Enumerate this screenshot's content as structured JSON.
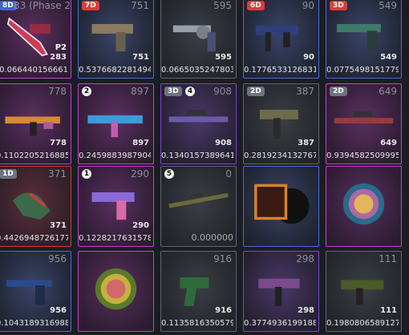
{
  "tiles": [
    {
      "rarity": "pink",
      "badge": "8D",
      "badge_color": "blue",
      "top": "",
      "phase": "83 (Phase 2)",
      "p2": "P2",
      "price": "283",
      "float": "0.066440156661",
      "art": "knife-red",
      "name": "knife-tile"
    },
    {
      "rarity": "blue",
      "badge": "7D",
      "badge_color": "red",
      "top": "751",
      "price": "751",
      "float": "0.5376682281494",
      "art": "pistol-tan",
      "name": "pistol-tile"
    },
    {
      "rarity": "gray",
      "badge": "",
      "top": "595",
      "price": "595",
      "float": "0.0665035247803",
      "art": "revolver",
      "name": "revolver-tile"
    },
    {
      "rarity": "blue",
      "badge": "6D",
      "badge_color": "red",
      "top": "90",
      "price": "90",
      "float": "0.1776533126831",
      "art": "smg-blue",
      "name": "smg-tile"
    },
    {
      "rarity": "blue",
      "badge": "3D",
      "badge_color": "red",
      "top": "549",
      "price": "549",
      "float": "0.0775498151779",
      "art": "pistol-green",
      "name": "pistol-tile-2"
    },
    {
      "rarity": "pink",
      "badge": "",
      "top": "778",
      "price": "778",
      "float": "0.1102205216885",
      "art": "rifle-ak",
      "name": "rifle-tile"
    },
    {
      "rarity": "pink",
      "num": "2",
      "top": "897",
      "price": "897",
      "float": "0.2459883987904",
      "art": "rifle-m4",
      "name": "rifle-tile-2"
    },
    {
      "rarity": "purple",
      "badge": "3D",
      "badge_color": "gray",
      "num": "4",
      "top": "908",
      "price": "908",
      "float": "0.1340157389641",
      "art": "sniper-purple",
      "name": "sniper-tile"
    },
    {
      "rarity": "gray",
      "badge": "2D",
      "badge_color": "gray",
      "top": "387",
      "price": "387",
      "float": "0.2819234132767",
      "art": "smg-olive",
      "name": "smg-tile-2"
    },
    {
      "rarity": "pink",
      "badge": "2D",
      "badge_color": "gray",
      "top": "649",
      "price": "649",
      "float": "0.9394582509995",
      "art": "sniper-red",
      "name": "sniper-tile-2"
    },
    {
      "rarity": "red",
      "badge": "1D",
      "badge_color": "gray",
      "top": "371",
      "price": "371",
      "float": "0.4426948726177",
      "art": "gloves",
      "name": "gloves-tile"
    },
    {
      "rarity": "pink",
      "num": "1",
      "top": "290",
      "price": "290",
      "float": "0.1228217631578",
      "art": "deagle",
      "name": "deagle-tile"
    },
    {
      "rarity": "gray",
      "num": "5",
      "top": "0",
      "price": "",
      "float": "0.000000",
      "art": "sniper-olive",
      "name": "sniper-tile-3",
      "dim": true
    },
    {
      "rarity": "blue",
      "top": "",
      "price": "",
      "float": "",
      "art": "music-kit",
      "name": "music-kit-tile"
    },
    {
      "rarity": "pink",
      "top": "",
      "price": "",
      "float": "",
      "art": "patch-1",
      "name": "patch-tile"
    },
    {
      "rarity": "blue",
      "top": "956",
      "price": "956",
      "float": "0.1043189316988",
      "art": "pistol-usp",
      "name": "pistol-tile-3"
    },
    {
      "rarity": "pink",
      "top": "",
      "price": "",
      "float": "",
      "art": "patch-2",
      "name": "patch-tile-2"
    },
    {
      "rarity": "gray",
      "top": "916",
      "price": "916",
      "float": "0.1135816350579",
      "art": "pistol-green2",
      "name": "pistol-tile-4"
    },
    {
      "rarity": "purple",
      "top": "298",
      "price": "298",
      "float": "0.3774936199188",
      "art": "smg-mp9",
      "name": "smg-tile-3"
    },
    {
      "rarity": "gray",
      "top": "111",
      "price": "111",
      "float": "0.1980806589127",
      "art": "smg-camo",
      "name": "smg-tile-4"
    }
  ]
}
